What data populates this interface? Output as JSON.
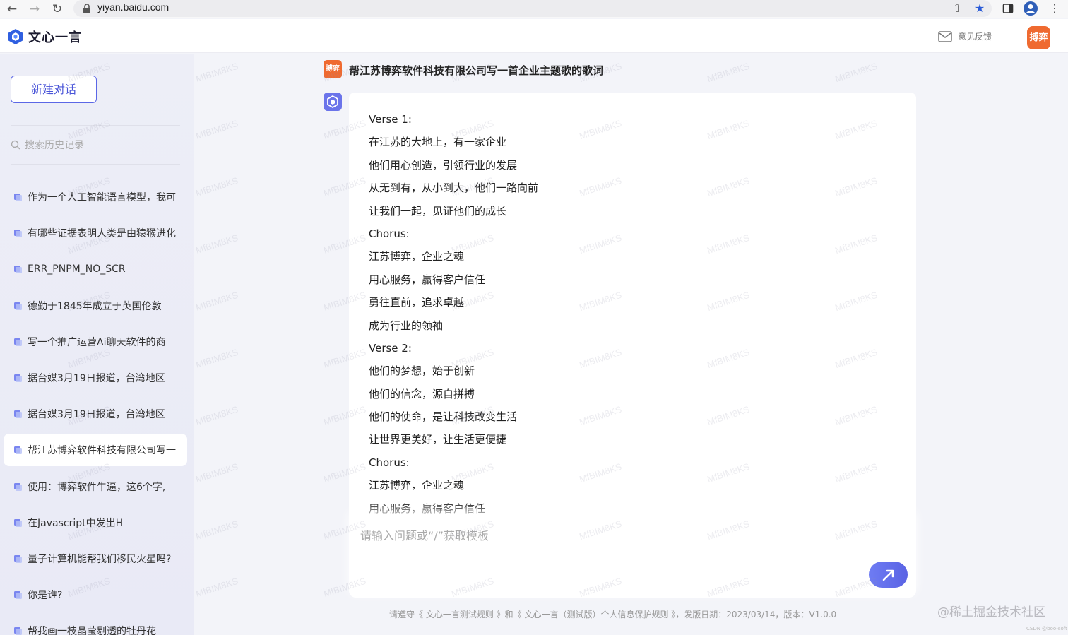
{
  "browser": {
    "url": "yiyan.baidu.com"
  },
  "header": {
    "logo_text": "文心一言",
    "feedback_label": "意见反馈",
    "avatar_text": "搏弈"
  },
  "sidebar": {
    "new_chat_label": "新建对话",
    "search_placeholder": "搜索历史记录",
    "history": [
      {
        "label": "作为一个人工智能语言模型，我可"
      },
      {
        "label": "有哪些证据表明人类是由猿猴进化"
      },
      {
        "label": "ERR_PNPM_NO_SCR"
      },
      {
        "label": "德勤于1845年成立于英国伦敦"
      },
      {
        "label": "写一个推广运营Ai聊天软件的商"
      },
      {
        "label": "据台媒3月19日报道，台湾地区"
      },
      {
        "label": "据台媒3月19日报道，台湾地区"
      },
      {
        "label": "帮江苏博弈软件科技有限公司写一"
      },
      {
        "label": "使用：博弈软件牛逼，这6个字,"
      },
      {
        "label": "在Javascript中发出H"
      },
      {
        "label": "量子计算机能帮我们移民火星吗?"
      },
      {
        "label": "你是谁?"
      },
      {
        "label": "帮我画一枝晶莹剔透的牡丹花"
      }
    ],
    "active_index": 7
  },
  "conversation": {
    "user_avatar_text": "搏弈",
    "question": "帮江苏博弈软件科技有限公司写一首企业主题歌的歌词",
    "answer_lines": [
      "Verse 1:",
      "在江苏的大地上，有一家企业",
      "他们用心创造，引领行业的发展",
      "从无到有，从小到大，他们一路向前",
      "让我们一起，见证他们的成长",
      "Chorus:",
      "江苏博弈，企业之魂",
      "用心服务，赢得客户信任",
      "勇往直前，追求卓越",
      "成为行业的领袖",
      "Verse 2:",
      "他们的梦想，始于创新",
      "他们的信念，源自拼搏",
      "他们的使命，是让科技改变生活",
      "让世界更美好，让生活更便捷",
      "Chorus:",
      "江苏博弈，企业之魂",
      "用心服务，赢得客户信任"
    ]
  },
  "input": {
    "placeholder": "请输入问题或“/”获取模板"
  },
  "footer": {
    "note": "请遵守《 文心一言测试规则 》和《 文心一言（测试版）个人信息保护规则 》，发版日期：2023/03/14，版本：V1.0.0"
  },
  "overlay": {
    "site_watermark": "@稀土掘金技术社区",
    "csdn_mark": "CSDN @boo-soft",
    "tile_watermark": "MfBIM8KS"
  },
  "colors": {
    "accent": "#5b67e6",
    "user_avatar": "#ef6a30",
    "sidebar_bg": "#edeef7",
    "main_bg": "#f3f4f9"
  }
}
